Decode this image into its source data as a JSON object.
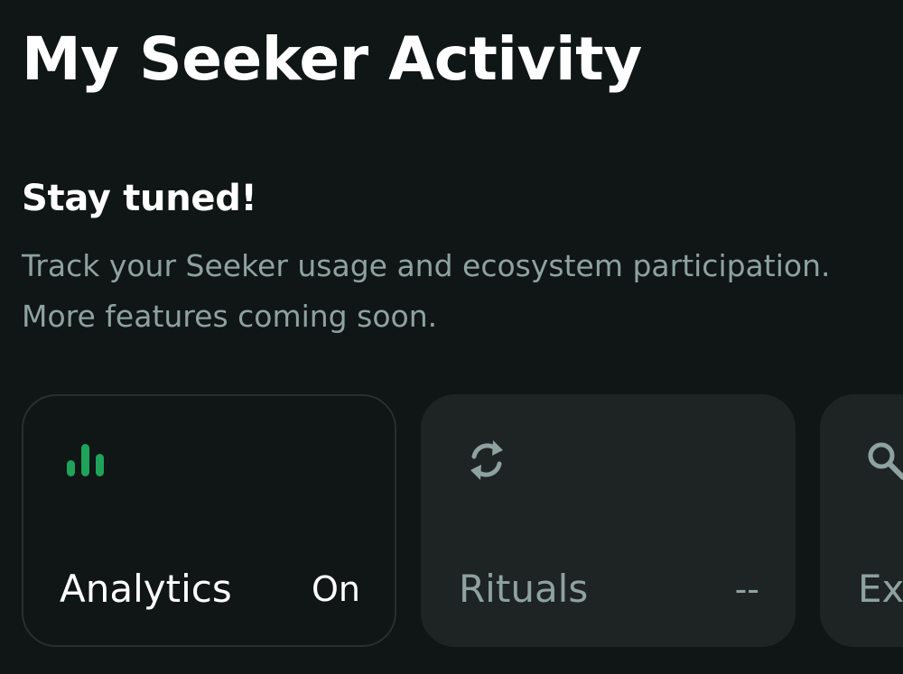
{
  "page": {
    "title": "My Seeker Activity"
  },
  "section": {
    "heading": "Stay tuned!",
    "description": "Track your Seeker usage and ecosystem participation. More features coming soon."
  },
  "cards": [
    {
      "label": "Analytics",
      "value": "On",
      "icon": "bar-chart-icon",
      "icon_color": "#1fa35a",
      "active": true
    },
    {
      "label": "Rituals",
      "value": "--",
      "icon": "sync-icon",
      "icon_color": "#8ea2a0",
      "active": false
    },
    {
      "label": "Ex",
      "value": "",
      "icon": "search-icon",
      "icon_color": "#8ea2a0",
      "active": false
    }
  ],
  "colors": {
    "background": "#0f1615",
    "card_inactive": "#1e2423",
    "accent_green": "#1fa35a",
    "muted_text": "#8ea2a0"
  }
}
